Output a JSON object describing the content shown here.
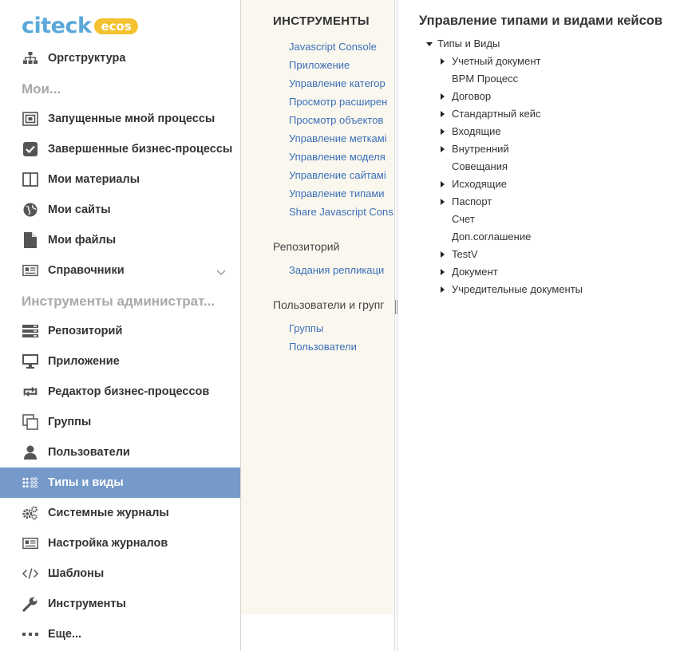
{
  "logo": {
    "word": "citeck",
    "badge": "ecos"
  },
  "sidebar": {
    "top_items": [
      {
        "label": "Оргструктура",
        "icon": "org-structure-icon"
      }
    ],
    "section_mine": "Мои...",
    "mine_items": [
      {
        "label": "Запущенные мной процессы",
        "icon": "started-processes-icon"
      },
      {
        "label": "Завершенные бизнес-процессы",
        "icon": "checkbox-icon"
      },
      {
        "label": "Мои материалы",
        "icon": "columns-icon"
      },
      {
        "label": "Мои сайты",
        "icon": "globe-icon"
      },
      {
        "label": "Мои файлы",
        "icon": "file-icon"
      },
      {
        "label": "Справочники",
        "icon": "reference-icon"
      }
    ],
    "section_admin": "Инструменты администрат...",
    "admin_items": [
      {
        "label": "Репозиторий",
        "icon": "repository-icon"
      },
      {
        "label": "Приложение",
        "icon": "monitor-icon"
      },
      {
        "label": "Редактор бизнес-процессов",
        "icon": "process-editor-icon"
      },
      {
        "label": "Группы",
        "icon": "groups-icon"
      },
      {
        "label": "Пользователи",
        "icon": "user-icon"
      },
      {
        "label": "Типы и виды",
        "icon": "types-icon"
      },
      {
        "label": "Системные журналы",
        "icon": "gears-icon"
      },
      {
        "label": "Настройка журналов",
        "icon": "journal-settings-icon"
      },
      {
        "label": "Шаблоны",
        "icon": "code-icon"
      },
      {
        "label": "Инструменты",
        "icon": "wrench-icon"
      },
      {
        "label": "Еще...",
        "icon": "more-icon"
      }
    ],
    "active_label": "Типы и виды",
    "active_color": "#7599c9"
  },
  "tools": {
    "heading": "ИНСТРУМЕНТЫ",
    "links": [
      "Javascript Console",
      "Приложение",
      "Управление категор",
      "Просмотр расширен",
      "Просмотр объектов",
      "Управление меткамі",
      "Управление моделя",
      "Управление сайтамі",
      "Управление типами",
      "Share Javascript Cons"
    ],
    "group_repo": "Репозиторий",
    "repo_links": [
      "Задания репликаци"
    ],
    "group_users": "Пользователи и групг",
    "users_links": [
      "Группы",
      "Пользователи"
    ],
    "link_color": "#3a6fb7",
    "background": "#faf7ef"
  },
  "main": {
    "title": "Управление типами и видами кейсов",
    "root": "Типы и Виды",
    "nodes": [
      {
        "label": "Учетный документ",
        "expandable": true
      },
      {
        "label": "BPM Процесс",
        "expandable": false
      },
      {
        "label": "Договор",
        "expandable": true
      },
      {
        "label": "Стандартный кейс",
        "expandable": true
      },
      {
        "label": "Входящие",
        "expandable": true
      },
      {
        "label": "Внутренний",
        "expandable": true
      },
      {
        "label": "Совещания",
        "expandable": false
      },
      {
        "label": "Исходящие",
        "expandable": true
      },
      {
        "label": "Паспорт",
        "expandable": true
      },
      {
        "label": "Счет",
        "expandable": false
      },
      {
        "label": "Доп.соглашение",
        "expandable": false
      },
      {
        "label": "TestV",
        "expandable": true
      },
      {
        "label": "Документ",
        "expandable": true
      },
      {
        "label": "Учредительные документы",
        "expandable": true
      }
    ]
  }
}
